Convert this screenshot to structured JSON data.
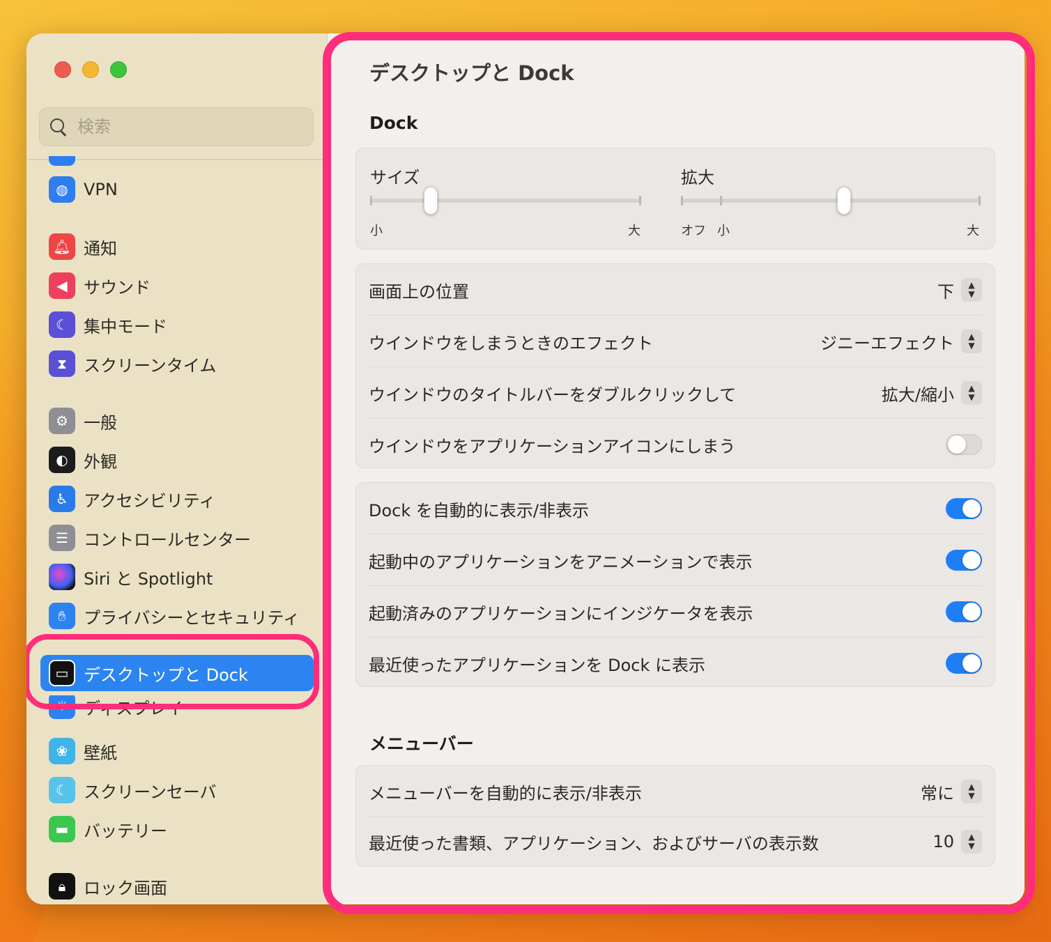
{
  "sidebar": {
    "search_placeholder": "検索",
    "items": [
      {
        "label": "VPN",
        "icon": "globe-shield-icon"
      },
      {
        "label": "通知",
        "icon": "bell-icon"
      },
      {
        "label": "サウンド",
        "icon": "speaker-icon"
      },
      {
        "label": "集中モード",
        "icon": "moon-icon"
      },
      {
        "label": "スクリーンタイム",
        "icon": "hourglass-icon"
      },
      {
        "label": "一般",
        "icon": "gear-icon"
      },
      {
        "label": "外観",
        "icon": "appearance-icon"
      },
      {
        "label": "アクセシビリティ",
        "icon": "accessibility-icon"
      },
      {
        "label": "コントロールセンター",
        "icon": "toggles-icon"
      },
      {
        "label": "Siri と Spotlight",
        "icon": "siri-icon"
      },
      {
        "label": "プライバシーとセキュリティ",
        "icon": "hand-icon"
      },
      {
        "label": "デスクトップと Dock",
        "icon": "desktop-dock-icon",
        "selected": true
      },
      {
        "label": "ディスプレイ",
        "icon": "sun-icon"
      },
      {
        "label": "壁紙",
        "icon": "flower-icon"
      },
      {
        "label": "スクリーンセーバ",
        "icon": "screensaver-icon"
      },
      {
        "label": "バッテリー",
        "icon": "battery-icon"
      },
      {
        "label": "ロック画面",
        "icon": "lock-icon"
      }
    ]
  },
  "main": {
    "title": "デスクトップと Dock",
    "dock_section": "Dock",
    "size": {
      "label": "サイズ",
      "min_label": "小",
      "max_label": "大",
      "value": 0.22
    },
    "magnification": {
      "label": "拡大",
      "off_label": "オフ",
      "min_label": "小",
      "max_label": "大",
      "value": 0.55
    },
    "position": {
      "label": "画面上の位置",
      "value": "下"
    },
    "minimize_effect": {
      "label": "ウインドウをしまうときのエフェクト",
      "value": "ジニーエフェクト"
    },
    "double_click": {
      "label": "ウインドウのタイトルバーをダブルクリックして",
      "value": "拡大/縮小"
    },
    "minimize_into_icon": {
      "label": "ウインドウをアプリケーションアイコンにしまう",
      "on": false
    },
    "auto_hide": {
      "label": "Dock を自動的に表示/非表示",
      "on": true
    },
    "animate": {
      "label": "起動中のアプリケーションをアニメーションで表示",
      "on": true
    },
    "indicators": {
      "label": "起動済みのアプリケーションにインジケータを表示",
      "on": true
    },
    "recent_apps": {
      "label": "最近使ったアプリケーションを Dock に表示",
      "on": true
    },
    "menubar_section": "メニューバー",
    "menubar_autohide": {
      "label": "メニューバーを自動的に表示/非表示",
      "value": "常に"
    },
    "recent_items": {
      "label": "最近使った書類、アプリケーション、およびサーバの表示数",
      "value": "10"
    }
  },
  "colors": {
    "accent": "#2c84f0",
    "highlight_ring": "#ff2d7a",
    "sidebar_bg": "#ebe2c6"
  }
}
